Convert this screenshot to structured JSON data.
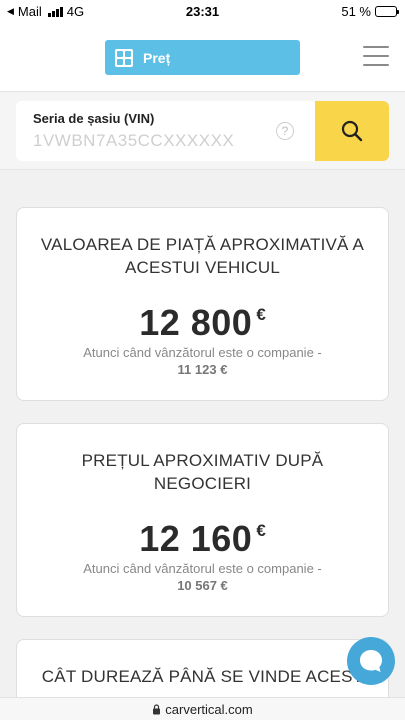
{
  "status": {
    "back_label": "Mail",
    "network": "4G",
    "time": "23:31",
    "battery": "51 %",
    "battery_level": 0.51
  },
  "header": {
    "price_label": "Preț"
  },
  "search": {
    "vin_label": "Seria de șasiu (VIN)",
    "vin_placeholder": "1VWBN7A35CCXXXXXX",
    "help_symbol": "?"
  },
  "cards": [
    {
      "title": "VALOAREA DE PIAȚĂ APROXIMATIVĂ A ACESTUI VEHICUL",
      "price": "12 800",
      "currency": "€",
      "note": "Atunci când vânzătorul este o companie -",
      "company_price": "11 123 €"
    },
    {
      "title": "PREȚUL APROXIMATIV DUPĂ NEGOCIERI",
      "price": "12 160",
      "currency": "€",
      "note": "Atunci când vânzătorul este o companie -",
      "company_price": "10 567 €"
    },
    {
      "title": "CÂT DUREAZĂ PÂNĂ SE VINDE ACEST"
    }
  ],
  "browser": {
    "url": "carvertical.com"
  },
  "colors": {
    "accent_blue": "#5bbfe6",
    "search_yellow": "#f9d549",
    "chat_blue": "#46a8d8"
  }
}
